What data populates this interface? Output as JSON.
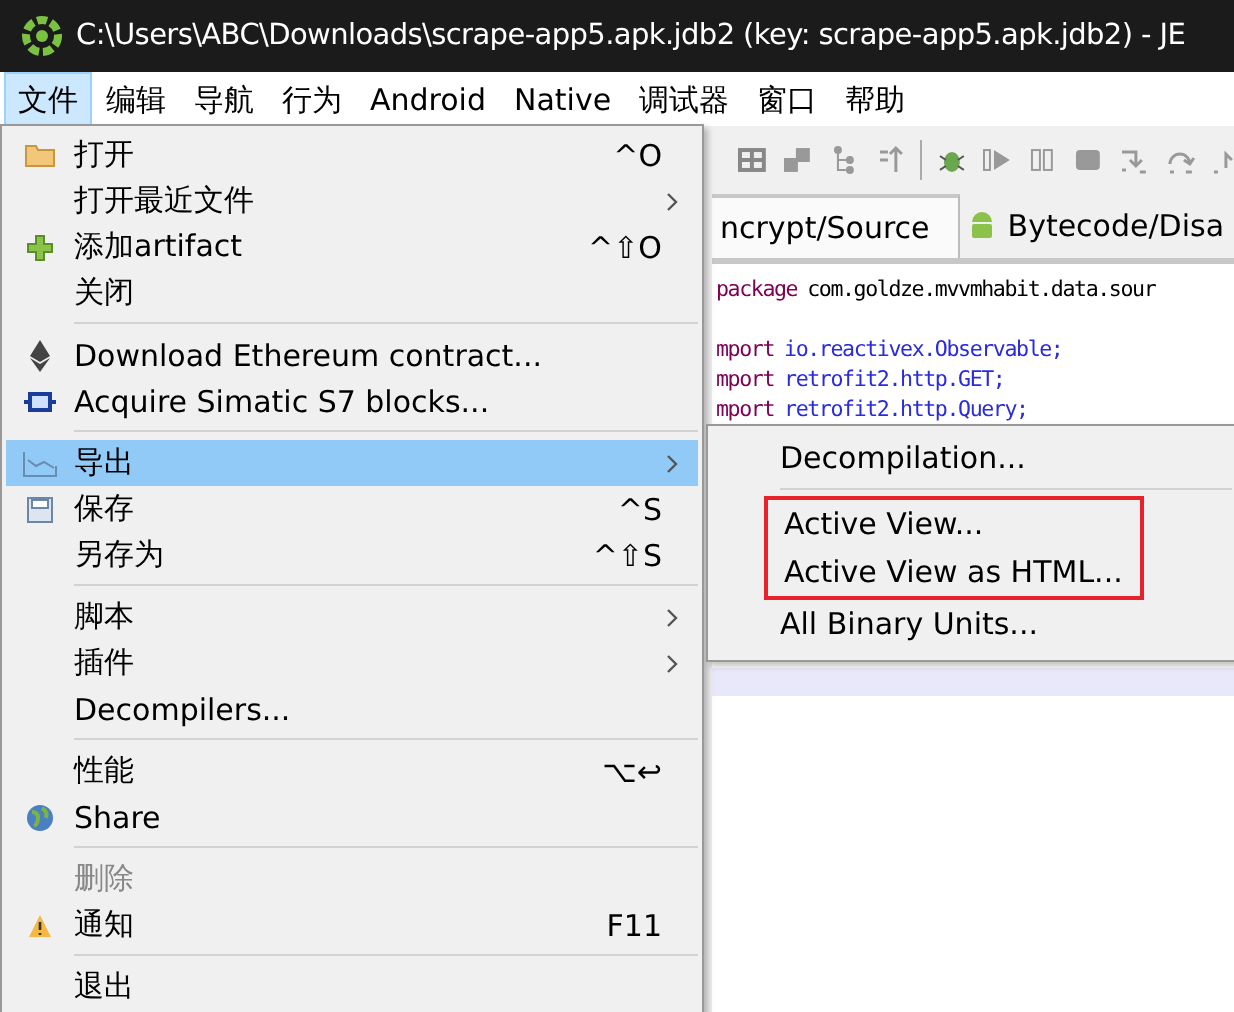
{
  "window": {
    "title": "C:\\Users\\ABC\\Downloads\\scrape-app5.apk.jdb2 (key: scrape-app5.apk.jdb2) - JE"
  },
  "menubar": [
    {
      "label": "文件",
      "selected": true
    },
    {
      "label": "编辑",
      "selected": false
    },
    {
      "label": "导航",
      "selected": false
    },
    {
      "label": "行为",
      "selected": false
    },
    {
      "label": "Android",
      "selected": false
    },
    {
      "label": "Native",
      "selected": false
    },
    {
      "label": "调试器",
      "selected": false
    },
    {
      "label": "窗口",
      "selected": false
    },
    {
      "label": "帮助",
      "selected": false
    }
  ],
  "tabs": [
    {
      "label": "ncrypt/Source",
      "selected": true
    },
    {
      "label": "Bytecode/Disa",
      "selected": false
    }
  ],
  "code": [
    {
      "keyword": "package",
      "rest": "com.goldze.mvvmhabit.data.sour"
    },
    {
      "keyword": "mport",
      "rest": "io.reactivex.Observable;"
    },
    {
      "keyword": "mport",
      "rest": "retrofit2.http.GET;"
    },
    {
      "keyword": "mport",
      "rest": "retrofit2.http.Query;"
    }
  ],
  "file_menu": [
    {
      "kind": "item",
      "label": "打开",
      "shortcut": "^O",
      "submenu": false,
      "selected": false,
      "disabled": false
    },
    {
      "kind": "item",
      "label": "打开最近文件",
      "submenu": true,
      "selected": false,
      "disabled": false
    },
    {
      "kind": "item",
      "label": "添加artifact",
      "shortcut": "^⇧O",
      "submenu": false,
      "selected": false,
      "disabled": false
    },
    {
      "kind": "item",
      "label": "关闭",
      "submenu": false,
      "selected": false,
      "disabled": false
    },
    {
      "kind": "separator"
    },
    {
      "kind": "item",
      "label": "Download Ethereum contract...",
      "submenu": false,
      "selected": false,
      "disabled": false
    },
    {
      "kind": "item",
      "label": "Acquire Simatic S7 blocks...",
      "submenu": false,
      "selected": false,
      "disabled": false
    },
    {
      "kind": "separator"
    },
    {
      "kind": "item",
      "label": "导出",
      "submenu": true,
      "selected": true,
      "disabled": false
    },
    {
      "kind": "item",
      "label": "保存",
      "shortcut": "^S",
      "submenu": false,
      "selected": false,
      "disabled": false
    },
    {
      "kind": "item",
      "label": "另存为",
      "shortcut": "^⇧S",
      "submenu": false,
      "selected": false,
      "disabled": false
    },
    {
      "kind": "separator"
    },
    {
      "kind": "item",
      "label": "脚本",
      "submenu": true,
      "selected": false,
      "disabled": false
    },
    {
      "kind": "item",
      "label": "插件",
      "submenu": true,
      "selected": false,
      "disabled": false
    },
    {
      "kind": "item",
      "label": "Decompilers...",
      "submenu": false,
      "selected": false,
      "disabled": false
    },
    {
      "kind": "separator"
    },
    {
      "kind": "item",
      "label": "性能",
      "shortcut": "⌥↩",
      "submenu": false,
      "selected": false,
      "disabled": false
    },
    {
      "kind": "item",
      "label": "Share",
      "submenu": false,
      "selected": false,
      "disabled": false
    },
    {
      "kind": "separator"
    },
    {
      "kind": "item",
      "label": "删除",
      "submenu": false,
      "selected": false,
      "disabled": true
    },
    {
      "kind": "item",
      "label": "通知",
      "shortcut": "F11",
      "submenu": false,
      "selected": false,
      "disabled": false
    },
    {
      "kind": "separator"
    },
    {
      "kind": "item",
      "label": "退出",
      "submenu": false,
      "selected": false,
      "disabled": false
    }
  ],
  "export_submenu": [
    {
      "kind": "item",
      "label": "Decompilation...",
      "highlighted": false
    },
    {
      "kind": "separator"
    },
    {
      "kind": "item",
      "label": "Active View...",
      "highlighted": true
    },
    {
      "kind": "item",
      "label": "Active View as HTML...",
      "highlighted": true
    },
    {
      "kind": "item",
      "label": "All Binary Units...",
      "highlighted": false
    }
  ]
}
